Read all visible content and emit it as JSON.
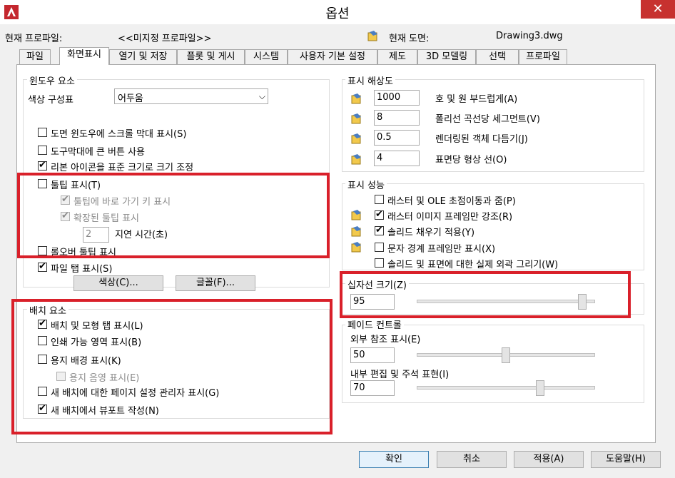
{
  "window": {
    "title": "옵션",
    "close_glyph": "✕"
  },
  "profile": {
    "current_profile_label": "현재 프로파일:",
    "current_profile_value": "<<미지정 프로파일>>",
    "current_drawing_label": "현재 도면:",
    "current_drawing_value": "Drawing3.dwg"
  },
  "tabs": [
    "파일",
    "화면표시",
    "열기 및 저장",
    "플롯 및 게시",
    "시스템",
    "사용자 기본 설정",
    "제도",
    "3D 모델링",
    "선택",
    "프로파일"
  ],
  "active_tab": "화면표시",
  "window_elements": {
    "title": "윈도우 요소",
    "color_scheme_label": "색상 구성표",
    "color_scheme_value": "어두움",
    "scrollbars": {
      "label": "도면 윈도우에 스크롤 막대 표시(S)",
      "checked": false
    },
    "large_buttons": {
      "label": "도구막대에 큰 버튼 사용",
      "checked": false
    },
    "ribbon_resize": {
      "label": "리본 아이콘을 표준 크기로 크기 조정",
      "checked": true
    },
    "tooltips": {
      "label": "툴팁 표시(T)",
      "checked": false
    },
    "shortcut_keys": {
      "label": "툴팁에 바로 가기 키 표시",
      "checked": true
    },
    "extended_tooltips": {
      "label": "확장된 툴팁 표시",
      "checked": true
    },
    "delay_value": "2",
    "delay_label": "지연 시간(초)",
    "rollover": {
      "label": "롤오버 툴팁 표시",
      "checked": false
    },
    "file_tabs": {
      "label": "파일 탭 표시(S)",
      "checked": true
    },
    "colors_button": "색상(C)...",
    "fonts_button": "글꼴(F)..."
  },
  "layout_elements": {
    "title": "배치 요소",
    "layout_model_tabs": {
      "label": "배치 및 모형 탭 표시(L)",
      "checked": true
    },
    "printable_area": {
      "label": "인쇄 가능 영역 표시(B)",
      "checked": false
    },
    "paper_background": {
      "label": "용지 배경 표시(K)",
      "checked": false
    },
    "paper_shadow": {
      "label": "용지 음영 표시(E)",
      "checked": false
    },
    "page_setup_manager": {
      "label": "새 배치에 대한 페이지 설정 관리자 표시(G)",
      "checked": false
    },
    "create_viewport": {
      "label": "새 배치에서 뷰포트 작성(N)",
      "checked": true
    }
  },
  "display_resolution": {
    "title": "표시 해상도",
    "rows": [
      {
        "value": "1000",
        "label": "호 및 원 부드럽게(A)"
      },
      {
        "value": "8",
        "label": "폴리선 곡선당 세그먼트(V)"
      },
      {
        "value": "0.5",
        "label": "렌더링된 객체 다듬기(J)"
      },
      {
        "value": "4",
        "label": "표면당 형상 선(O)"
      }
    ]
  },
  "display_performance": {
    "title": "표시 성능",
    "items": [
      {
        "label": "래스터 및 OLE 초점이동과 줌(P)",
        "checked": false,
        "icon": false
      },
      {
        "label": "래스터 이미지 프레임만 강조(R)",
        "checked": true,
        "icon": true
      },
      {
        "label": "솔리드 채우기 적용(Y)",
        "checked": true,
        "icon": true
      },
      {
        "label": "문자 경계 프레임만 표시(X)",
        "checked": false,
        "icon": true
      },
      {
        "label": "솔리드 및 표면에 대한 실제 외곽 그리기(W)",
        "checked": false,
        "icon": false
      }
    ]
  },
  "crosshair": {
    "title": "십자선 크기(Z)",
    "value": "95",
    "level": 95
  },
  "fade_control": {
    "title": "페이드 컨트롤",
    "xref_label": "외부 참조 표시(E)",
    "xref_value": "50",
    "xref_level": 50,
    "inplace_label": "내부 편집 및 주석 표현(I)",
    "inplace_value": "70",
    "inplace_level": 70
  },
  "footer": {
    "ok": "확인",
    "cancel": "취소",
    "apply": "적용(A)",
    "help": "도움말(H)"
  },
  "colors": {
    "highlight": "#d9202a",
    "close": "#c7312f"
  }
}
